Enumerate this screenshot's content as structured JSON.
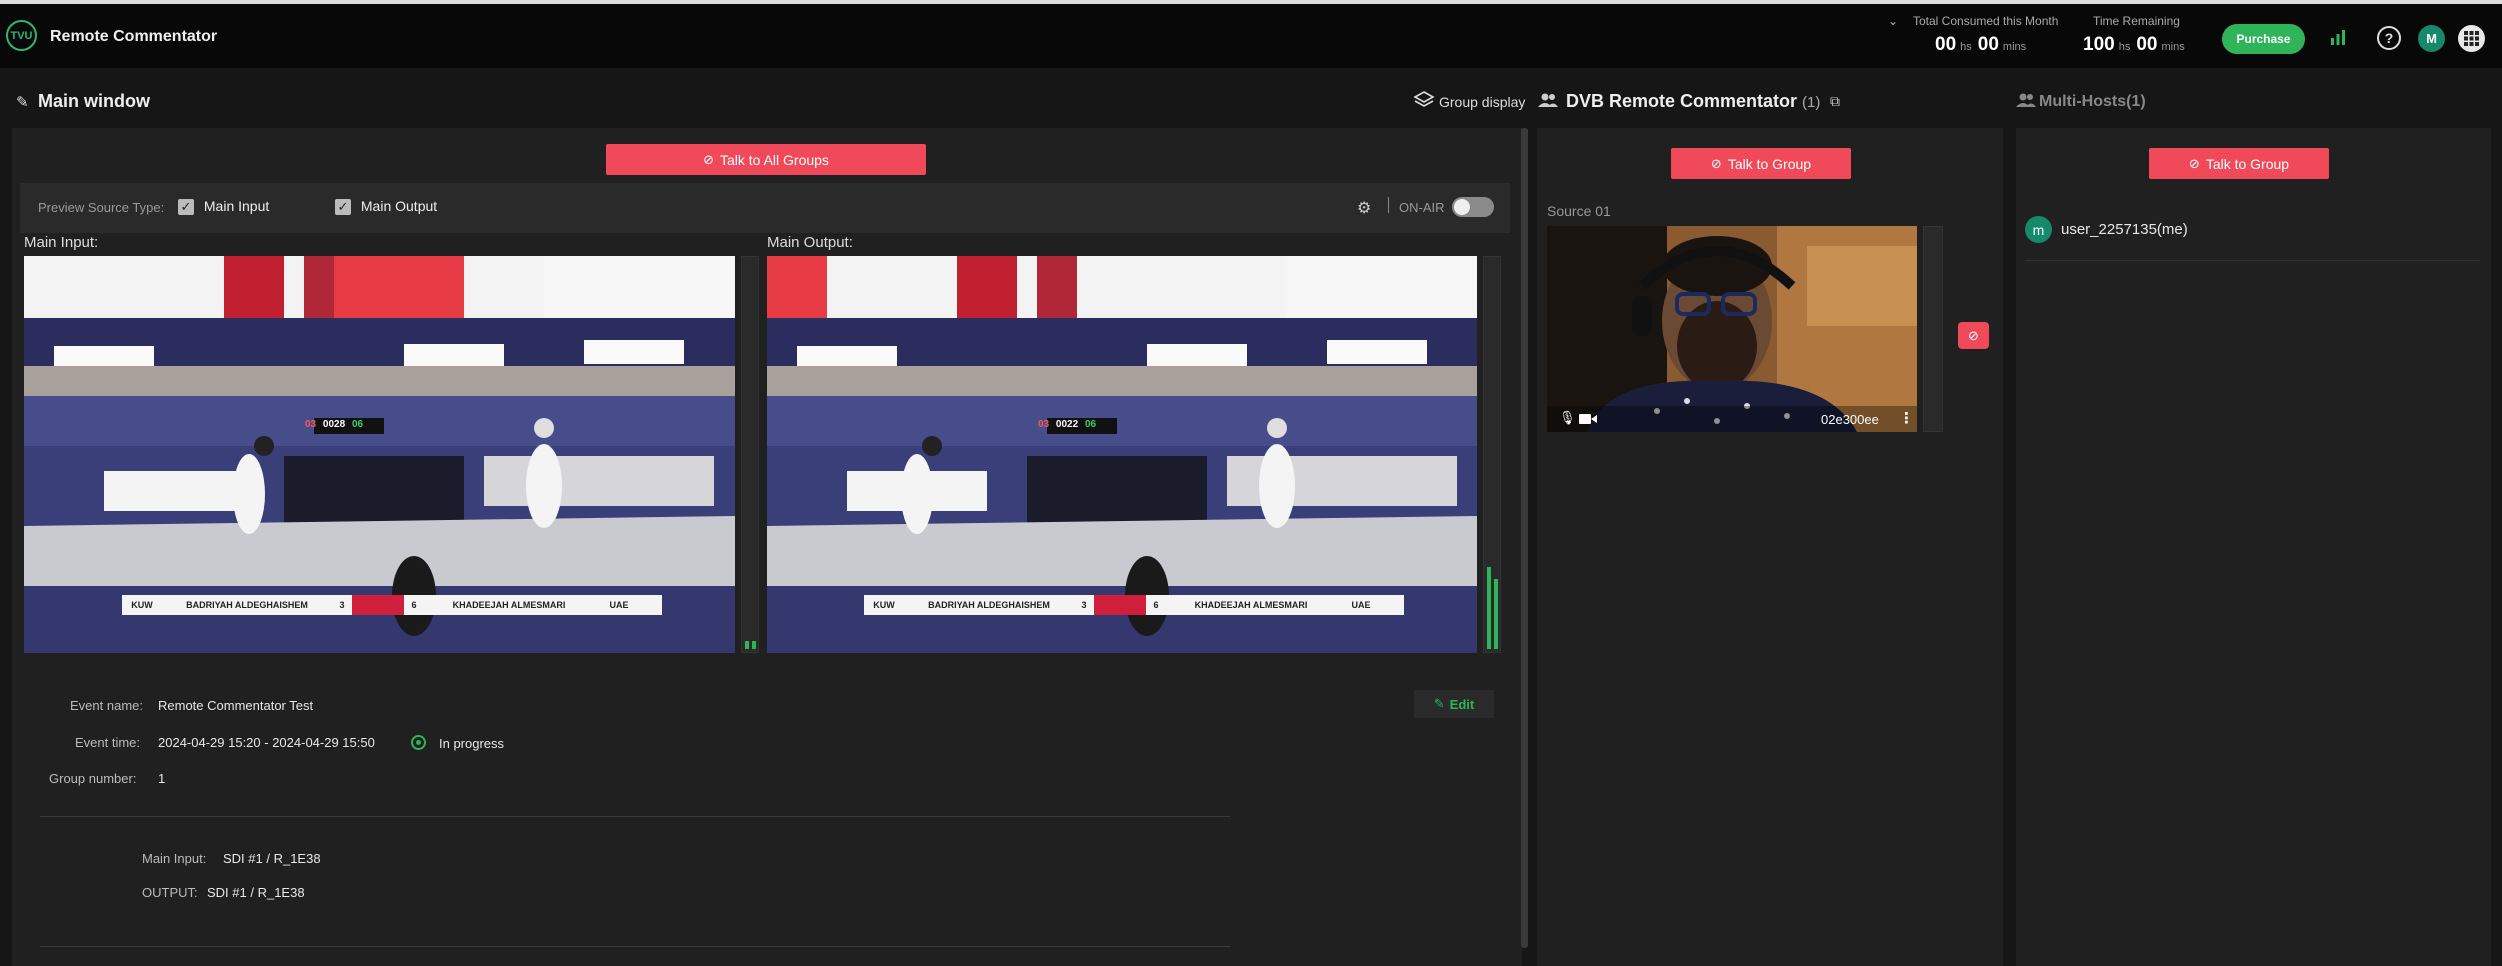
{
  "app": {
    "title": "Remote Commentator",
    "logo_text": "TVU"
  },
  "usage": {
    "consumed_label": "Total Consumed this Month",
    "consumed_hours": "00",
    "consumed_mins": "00",
    "remaining_label": "Time Remaining",
    "remaining_hours": "100",
    "remaining_mins": "00",
    "hs_unit": "hs",
    "mins_unit": "mins"
  },
  "header": {
    "purchase_label": "Purchase",
    "avatar_letter": "M"
  },
  "main_window": {
    "title": "Main window",
    "group_display_label": "Group display",
    "talk_all_label": "Talk to All Groups",
    "preview_source_label": "Preview Source Type:",
    "main_input_check": "Main Input",
    "main_output_check": "Main Output",
    "on_air_label": "ON-AIR",
    "main_input_title": "Main Input:",
    "main_output_title": "Main Output:",
    "edit_label": "Edit",
    "event_name_label": "Event name:",
    "event_name": "Remote Commentator Test",
    "event_time_label": "Event time:",
    "event_time": "2024-04-29 15:20 - 2024-04-29 15:50",
    "status": "In progress",
    "group_number_label": "Group number:",
    "group_number": "1",
    "main_input_label": "Main Input:",
    "main_input_value": "SDI #1 / R_1E38",
    "output_label": "OUTPUT:",
    "output_value": "SDI #1 / R_1E38"
  },
  "scoreboard": {
    "input": {
      "left_code": "KUW",
      "left_name": "BADRIYAH ALDEGHAISHEM",
      "left_score": "3",
      "right_score": "6",
      "right_name": "KHADEEJAH ALMESMARI",
      "right_code": "UAE",
      "clock": "0028",
      "l": "03",
      "r": "06"
    },
    "output": {
      "left_code": "KUW",
      "left_name": "BADRIYAH ALDEGHAISHEM",
      "left_score": "3",
      "right_score": "6",
      "right_name": "KHADEEJAH ALMESMARI",
      "right_code": "UAE",
      "clock": "0022",
      "l": "03",
      "r": "06"
    }
  },
  "group": {
    "title": "DVB Remote Commentator",
    "count": "(1)",
    "talk_label": "Talk to Group",
    "source_label": "Source 01",
    "source_id": "02e300ee"
  },
  "multi_hosts": {
    "title": "Multi-Hosts(1)",
    "talk_label": "Talk to Group",
    "user_name": "user_2257135(me)",
    "user_avatar_letter": "m"
  },
  "colors": {
    "accent_red": "#f04a5a",
    "accent_green": "#2fb45a",
    "panel": "#202020"
  }
}
